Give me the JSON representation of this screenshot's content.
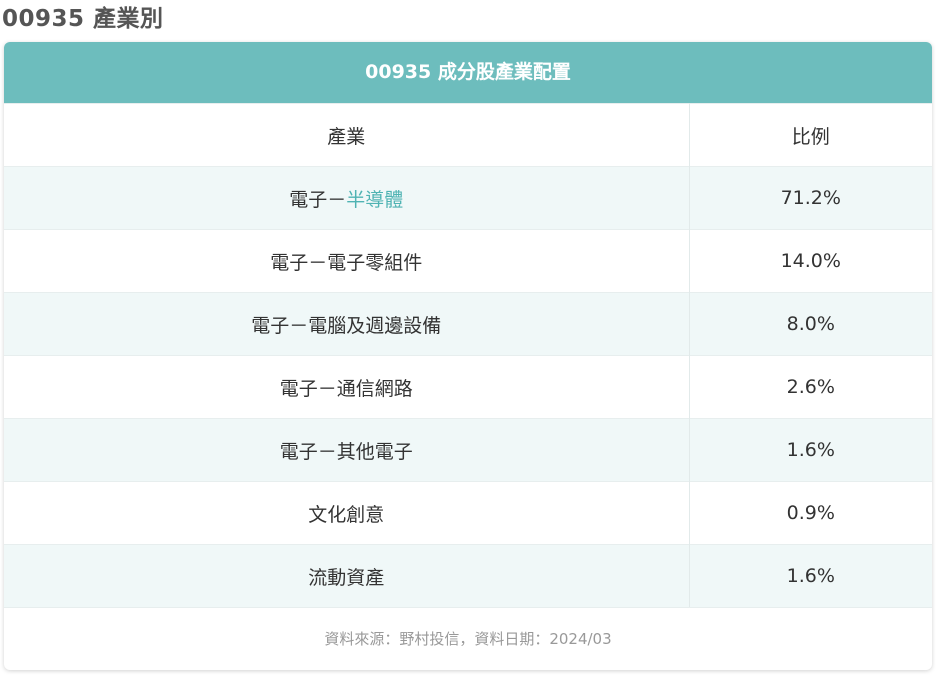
{
  "page_title": "00935 產業別",
  "card": {
    "header": "00935 成分股產業配置",
    "columns": [
      "產業",
      "比例"
    ],
    "rows": [
      {
        "prefix": "電子－",
        "link": "半導體",
        "ratio": "71.2%"
      },
      {
        "industry": "電子－電子零組件",
        "ratio": "14.0%"
      },
      {
        "industry": "電子－電腦及週邊設備",
        "ratio": "8.0%"
      },
      {
        "industry": "電子－通信網路",
        "ratio": "2.6%"
      },
      {
        "industry": "電子－其他電子",
        "ratio": "1.6%"
      },
      {
        "industry": "文化創意",
        "ratio": "0.9%"
      },
      {
        "industry": "流動資產",
        "ratio": "1.6%"
      }
    ],
    "footer": "資料來源：野村投信，資料日期：2024/03"
  },
  "colors": {
    "header_bg": "#6dbdbd",
    "link": "#4fb3b3",
    "row_alt_bg": "#f0f8f8"
  }
}
